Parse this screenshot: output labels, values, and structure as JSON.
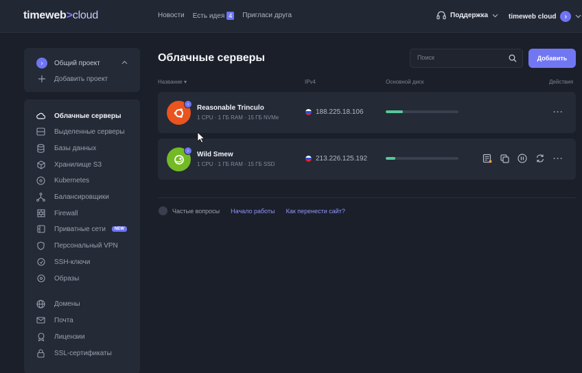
{
  "header": {
    "logo_main": "timeweb",
    "logo_arrow": ">",
    "logo_sub": "cloud",
    "nav": [
      {
        "label": "Новости"
      },
      {
        "label": "Есть идея",
        "badge": "4"
      },
      {
        "label": "Пригласи друга"
      }
    ],
    "support_label": "Поддержка",
    "account_label": "timeweb cloud"
  },
  "project": {
    "current": "Общий проект",
    "add_label": "Добавить проект"
  },
  "sidebar": {
    "items": [
      {
        "label": "Облачные серверы",
        "icon": "cloud-icon",
        "active": true
      },
      {
        "label": "Выделенные серверы",
        "icon": "server-icon"
      },
      {
        "label": "Базы данных",
        "icon": "database-icon"
      },
      {
        "label": "Хранилище S3",
        "icon": "cube-icon"
      },
      {
        "label": "Kubernetes",
        "icon": "kubernetes-icon"
      },
      {
        "label": "Балансировщики",
        "icon": "balancer-icon"
      },
      {
        "label": "Firewall",
        "icon": "firewall-icon"
      },
      {
        "label": "Приватные сети",
        "icon": "network-icon",
        "badge": "NEW"
      },
      {
        "label": "Персональный VPN",
        "icon": "shield-icon"
      },
      {
        "label": "SSH-ключи",
        "icon": "key-icon"
      },
      {
        "label": "Образы",
        "icon": "disc-icon"
      },
      {
        "label": "Домены",
        "icon": "globe-icon"
      },
      {
        "label": "Почта",
        "icon": "mail-icon"
      },
      {
        "label": "Лицензии",
        "icon": "license-icon"
      },
      {
        "label": "SSL-сертификаты",
        "icon": "lock-icon"
      }
    ]
  },
  "main": {
    "title": "Облачные серверы",
    "search_placeholder": "Поиск",
    "add_button": "Добавить",
    "columns": {
      "name": "Название",
      "ipv4": "IPv4",
      "disk": "Основной диск",
      "actions": "Действия"
    },
    "servers": [
      {
        "name": "Reasonable Trinculo",
        "spec": "1 CPU · 1 ГБ RAM · 15 ГБ NVMe",
        "ip": "188.225.18.106",
        "disk_fraction": 0.24,
        "os_icon": "ubuntu-icon",
        "avatar_color": "#e9541f"
      },
      {
        "name": "Wild Smew",
        "spec": "1 CPU · 1 ГБ RAM · 15 ГБ SSD",
        "ip": "213.226.125.192",
        "disk_fraction": 0.13,
        "os_icon": "opensuse-icon",
        "avatar_color": "#73ba25"
      }
    ],
    "faq": {
      "label": "Частые вопросы",
      "links": [
        "Начало работы",
        "Как перенести сайт?"
      ]
    }
  },
  "colors": {
    "accent": "#6f75f2",
    "disk_fill": "#57c89a"
  }
}
